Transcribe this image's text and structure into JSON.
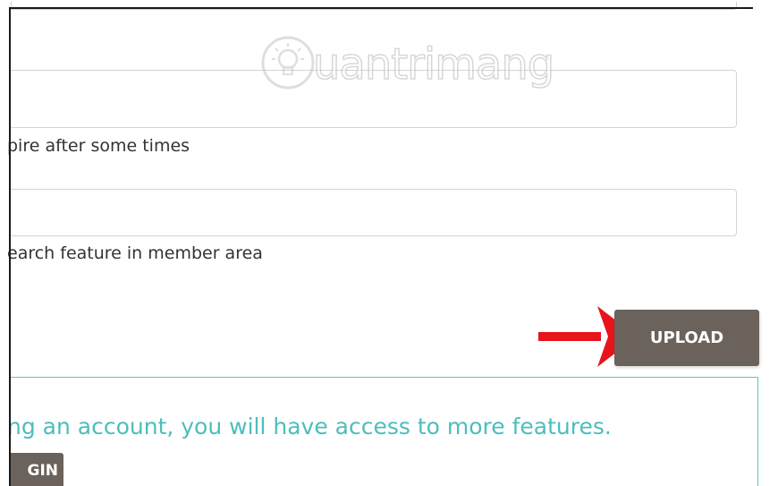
{
  "form": {
    "field_1_value": "",
    "hint_1": "pire after some times",
    "field_2_value": "",
    "hint_2": "earch feature in member area",
    "upload_label": "UPLOAD"
  },
  "info": {
    "message": "ng an account, you will have access to more features.",
    "login_label": "GIN"
  },
  "watermark": {
    "text": "uantrimang",
    "icon": "lightbulb-icon"
  },
  "colors": {
    "button_bg": "#6a625b",
    "info_border": "#5bc7c7",
    "info_text": "#4dbdbd",
    "arrow": "#e8141b"
  }
}
